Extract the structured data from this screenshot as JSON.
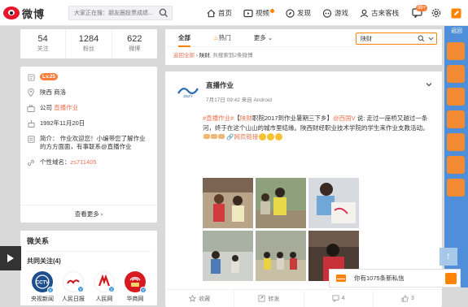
{
  "topbar": {
    "brand": "微博",
    "search_placeholder": "大家正在搜：朋友圈投票成绩...",
    "nav": [
      {
        "label": "首页",
        "icon": "home-icon"
      },
      {
        "label": "视频",
        "icon": "video-icon"
      },
      {
        "label": "发现",
        "icon": "compass-icon"
      },
      {
        "label": "游戏",
        "icon": "game-icon"
      },
      {
        "label": "古来客栈",
        "icon": "user-icon"
      }
    ],
    "message_badge": "99+"
  },
  "profile": {
    "stats": [
      {
        "num": "54",
        "label": "关注"
      },
      {
        "num": "1284",
        "label": "粉丝"
      },
      {
        "num": "622",
        "label": "微博"
      }
    ],
    "level": "Lv.25",
    "location": "陕西 商洛",
    "company_prefix": "公司",
    "company": "直播作业",
    "birthday": "1992年11月20日",
    "intro": "简介： 作业欢迎您！小编带您了解作业的方方面面，有事联系@直播作业",
    "domain_prefix": "个性域名：",
    "domain": "zs711405",
    "more": "查看更多 ›"
  },
  "relations": {
    "title": "微关系",
    "common_label": "共同关注(4)",
    "accounts": [
      {
        "name": "央视新闻",
        "color": "#1f4e8c"
      },
      {
        "name": "人民日报",
        "color": "#c8161d"
      },
      {
        "name": "人民网",
        "color": "#d9161d"
      },
      {
        "name": "华商网",
        "color": "#d71920"
      }
    ]
  },
  "feed": {
    "tabs": [
      "全部",
      "热门",
      "更多"
    ],
    "search_value": "陕财",
    "crumb_all": "返回全部",
    "crumb_keyword": "陕财",
    "crumb_count": "共搜索到2条微博"
  },
  "post": {
    "author": "直播作业",
    "time": "7月17日 09:42 来自 Android",
    "text_tag": "#直播作业#",
    "text_bracket_open": "【",
    "text_hl": "陕财",
    "text_a": "职院2017到作业暑期三下乡】",
    "text_mention": "@西国V",
    "text_b": " 说: 走过一座桥又越过一条河，终于在这个山山的城市里结缘。陕西财经职业技术学院的学生来作业支教活动。",
    "link": "网页链接",
    "actions": [
      {
        "label": "收藏",
        "icon": "star-icon"
      },
      {
        "label": "转发",
        "icon": "repost-icon"
      },
      {
        "label": "4",
        "icon": "comment-icon"
      },
      {
        "label": "3",
        "icon": "like-icon"
      }
    ]
  },
  "side": {
    "tab_label": "返回"
  },
  "chat": {
    "text": "你有1075条新私信"
  }
}
